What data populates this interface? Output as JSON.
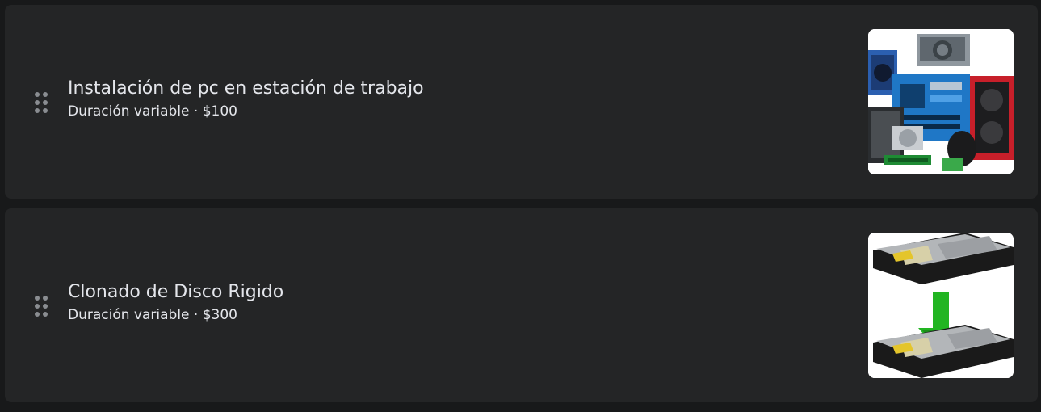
{
  "services": [
    {
      "title": "Instalación de pc en estación de trabajo",
      "duration": "Duración variable",
      "separator": "·",
      "price": "$100",
      "image_icon": "pc-components-image"
    },
    {
      "title": "Clonado de Disco Rigido",
      "duration": "Duración variable",
      "separator": "·",
      "price": "$300",
      "image_icon": "hard-disk-clone-image"
    }
  ],
  "colors": {
    "page_background": "#18191a",
    "card_background": "#242526",
    "text_primary": "#e4e6eb",
    "drag_handle": "#8a8d91",
    "arrow_green": "#22b522"
  }
}
